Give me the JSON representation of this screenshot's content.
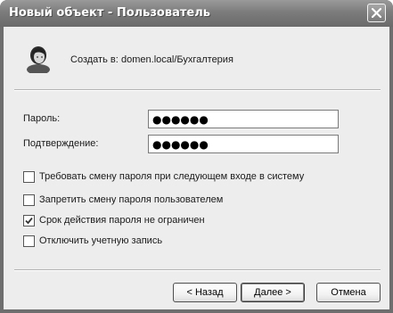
{
  "window": {
    "title": "Новый объект - Пользователь"
  },
  "header": {
    "create_label": "Создать в:",
    "create_path": "domen.local/Бухгалтерия"
  },
  "fields": {
    "password_label": "Пароль:",
    "password_value": "●●●●●●",
    "confirm_label": "Подтверждение:",
    "confirm_value": "●●●●●●"
  },
  "options": [
    {
      "label": "Требовать смену пароля при следующем входе в систему",
      "checked": false
    },
    {
      "label": "Запретить смену пароля пользователем",
      "checked": false
    },
    {
      "label": "Срок действия пароля не ограничен",
      "checked": true
    },
    {
      "label": "Отключить учетную запись",
      "checked": false
    }
  ],
  "buttons": {
    "back": "< Назад",
    "next": "Далее >",
    "cancel": "Отмена"
  }
}
